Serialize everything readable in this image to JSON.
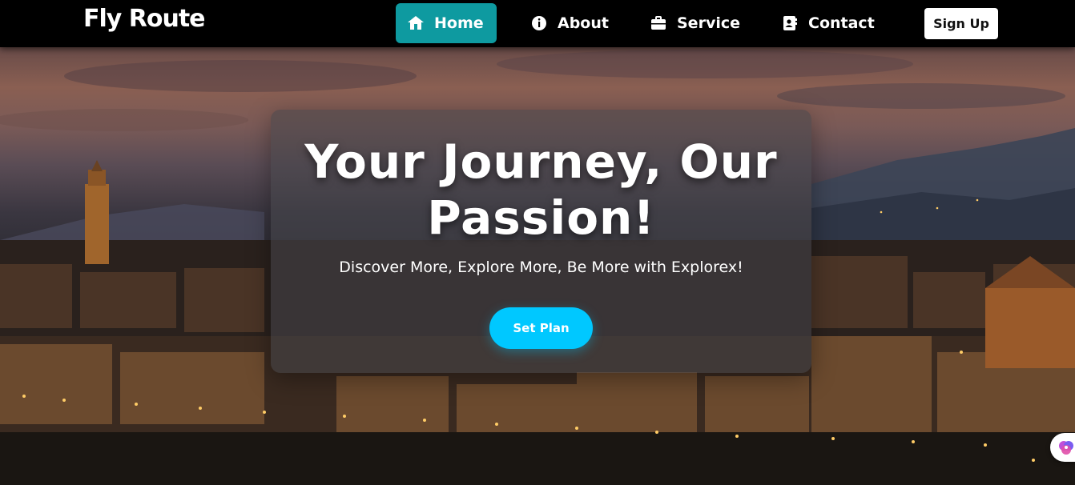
{
  "navbar": {
    "brand": "Fly Route",
    "items": [
      {
        "label": "Home",
        "icon": "home-icon",
        "active": true
      },
      {
        "label": "About",
        "icon": "info-icon",
        "active": false
      },
      {
        "label": "Service",
        "icon": "briefcase-icon",
        "active": false
      },
      {
        "label": "Contact",
        "icon": "contact-card-icon",
        "active": false
      }
    ],
    "signup_label": "Sign Up"
  },
  "hero": {
    "title_line1": "Your Journey, Our",
    "title_line2": "Passion!",
    "subtitle": "Discover More, Explore More, Be More with Explorex!",
    "cta_label": "Set Plan"
  },
  "colors": {
    "navbar_bg": "#000000",
    "active_tab": "#0e9aa0",
    "cta": "#00c8ff",
    "text": "#ffffff"
  },
  "floating_widget": {
    "icon": "assistant-icon"
  }
}
